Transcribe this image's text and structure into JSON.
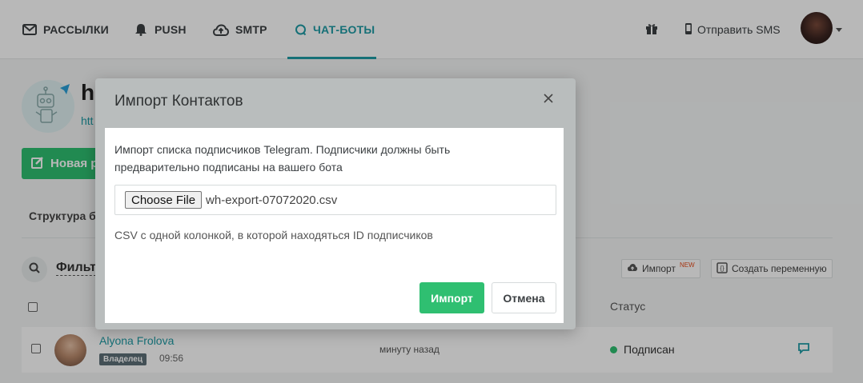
{
  "nav": {
    "items": [
      {
        "label": "РАССЫЛКИ",
        "icon": "envelope-icon"
      },
      {
        "label": "PUSH",
        "icon": "bell-icon"
      },
      {
        "label": "SMTP",
        "icon": "cloud-upload-icon"
      },
      {
        "label": "ЧАТ-БОТЫ",
        "icon": "chat-bubble-icon",
        "active": true
      }
    ],
    "send_sms_label": "Отправить SMS",
    "gift_icon": "gift-icon",
    "phone_icon": "phone-icon"
  },
  "page": {
    "bot_title": "h",
    "bot_link": "htt",
    "new_button_label": "Новая р",
    "structure_tab": "Структура б",
    "filter_label": "Фильт",
    "import_button_label": "Импорт",
    "import_new_tag": "NEW",
    "create_variable_label": "Создать переменную",
    "status_header": "Статус",
    "row": {
      "name": "Alyona Frolova",
      "badge": "Владелец",
      "time": "09:56",
      "ago": "минуту назад",
      "status": "Подписан"
    }
  },
  "modal": {
    "title": "Импорт Контактов",
    "description": "Импорт списка подписчиков Telegram. Подписчики должны быть предварительно подписаны на вашего бота",
    "choose_file_label": "Choose File",
    "file_name": "wh-export-07072020.csv",
    "hint": "CSV с одной колонкой, в которой находяться ID подписчиков",
    "import_label": "Импорт",
    "cancel_label": "Отмена"
  },
  "colors": {
    "accent": "#1f9ca6",
    "primary_button": "#2fbf71",
    "status_subscribed": "#2fbf71"
  }
}
